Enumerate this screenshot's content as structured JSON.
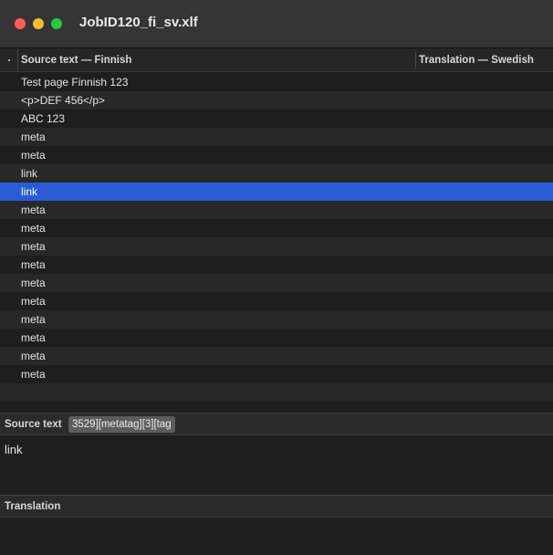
{
  "window": {
    "title": "JobID120_fi_sv.xlf"
  },
  "table": {
    "columns": {
      "source": "Source text — Finnish",
      "translation": "Translation — Swedish"
    },
    "rows": [
      {
        "source": "Test page Finnish 123",
        "translation": ""
      },
      {
        "source": "<p>DEF 456</p>",
        "translation": ""
      },
      {
        "source": "ABC 123",
        "translation": ""
      },
      {
        "source": "meta",
        "translation": ""
      },
      {
        "source": "meta",
        "translation": ""
      },
      {
        "source": "link",
        "translation": ""
      },
      {
        "source": "link",
        "translation": "",
        "selected": true
      },
      {
        "source": "meta",
        "translation": ""
      },
      {
        "source": "meta",
        "translation": ""
      },
      {
        "source": "meta",
        "translation": ""
      },
      {
        "source": "meta",
        "translation": ""
      },
      {
        "source": "meta",
        "translation": ""
      },
      {
        "source": "meta",
        "translation": ""
      },
      {
        "source": "meta",
        "translation": ""
      },
      {
        "source": "meta",
        "translation": ""
      },
      {
        "source": "meta",
        "translation": ""
      },
      {
        "source": "meta",
        "translation": ""
      }
    ]
  },
  "source_panel": {
    "label": "Source text",
    "tag": "3529][metatag][3][tag",
    "text": "link"
  },
  "translation_panel": {
    "label": "Translation",
    "text": ""
  },
  "colors": {
    "selection": "#2a5bd6",
    "close": "#ff5f57",
    "minimize": "#febc2e",
    "maximize": "#28c840"
  }
}
